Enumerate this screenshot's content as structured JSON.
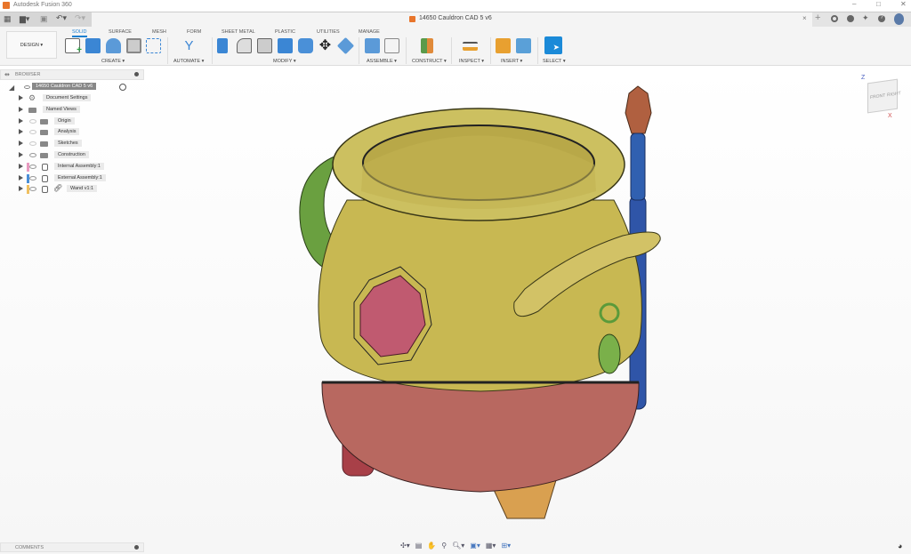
{
  "app": {
    "title": "Autodesk Fusion 360"
  },
  "document": {
    "tab_title": "14650 Cauldron CAD 5 v6"
  },
  "window_controls": {
    "minimize": "–",
    "maximize": "□",
    "close": "✕"
  },
  "ribbon": {
    "workspace": "DESIGN ▾",
    "tabs": [
      "SOLID",
      "SURFACE",
      "MESH",
      "FORM",
      "SHEET METAL",
      "PLASTIC",
      "UTILITIES",
      "MANAGE"
    ],
    "active_tab": "SOLID",
    "groups": [
      "CREATE ▾",
      "AUTOMATE ▾",
      "MODIFY ▾",
      "ASSEMBLE ▾",
      "CONSTRUCT ▾",
      "INSPECT ▾",
      "INSERT ▾",
      "SELECT ▾"
    ]
  },
  "browser": {
    "title": "BROWSER",
    "root": "14650 Cauldron CAD 5 v6",
    "items": [
      "Document Settings",
      "Named Views",
      "Origin",
      "Analysis",
      "Sketches",
      "Construction",
      "Internal Assembly:1",
      "External Assembly:1",
      "Wand v1:1"
    ],
    "component_colors": [
      "#e89ac0",
      "#4a8fd8",
      "#f0c060"
    ]
  },
  "comments": {
    "title": "COMMENTS"
  },
  "viewcube": {
    "front": "FRONT",
    "right": "RIGHT",
    "z": "Z",
    "x": "X"
  },
  "colors": {
    "accent": "#1b7fd0",
    "cauldron_top": "#c8b852",
    "cauldron_bottom": "#b05a58",
    "gem": "#c05a70",
    "wand": "#2f55a8"
  }
}
